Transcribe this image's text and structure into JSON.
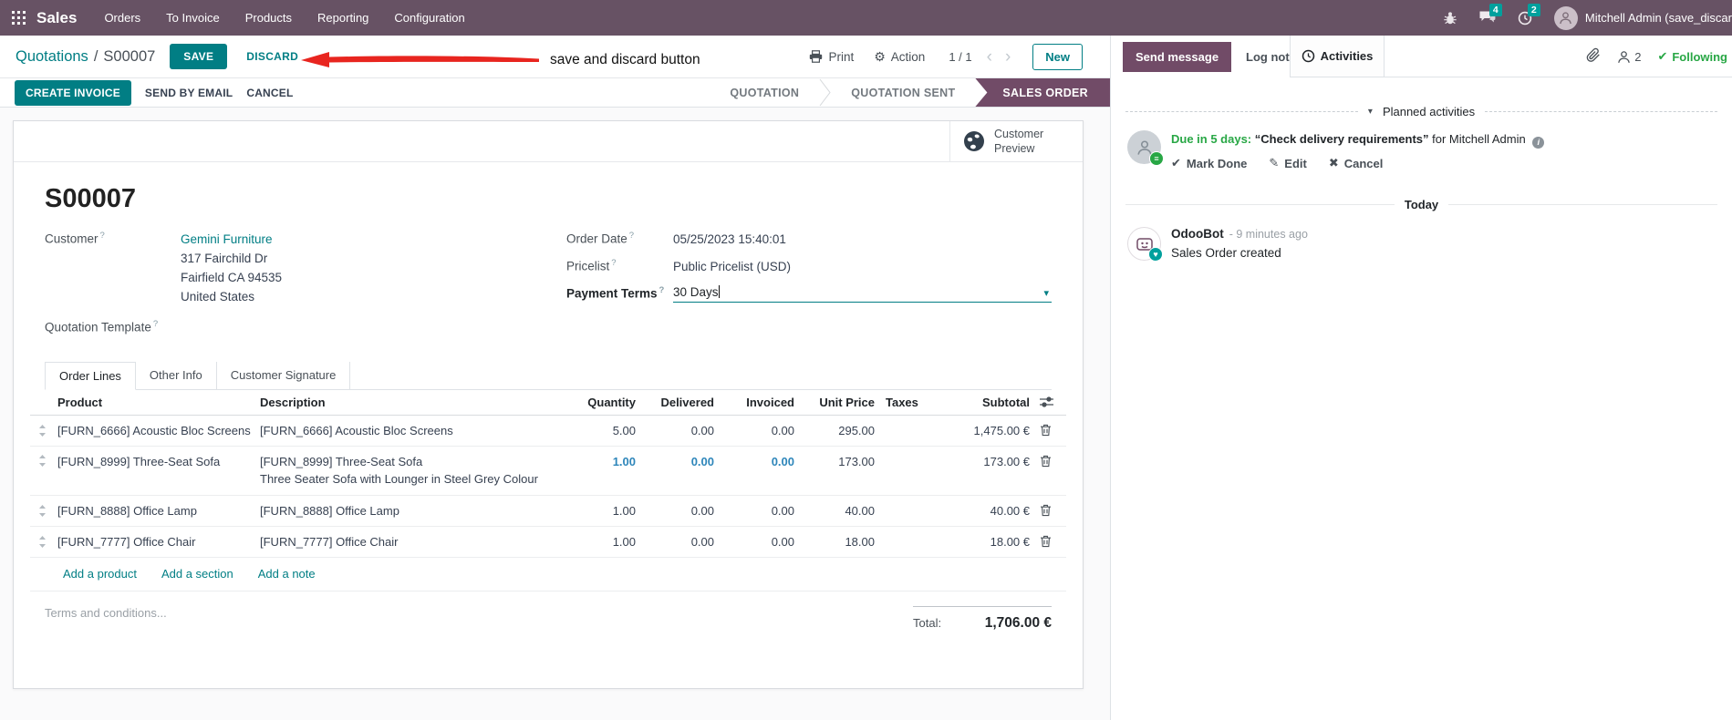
{
  "ui": {
    "help": "?",
    "caret_down": "▾",
    "chevron_left": "‹",
    "chevron_right": "›",
    "gear": "⚙",
    "check": "✔",
    "pencil": "✎",
    "cross": "✖",
    "heart": "♥",
    "list": "≡",
    "info": "i"
  },
  "colors": {
    "navbar": "#675264",
    "primary_teal": "#017e84",
    "purple": "#714B67",
    "badge_teal": "#00a09d",
    "green": "#28a745",
    "modified_blue": "#2e86ba",
    "annotation_red": "#e8251f"
  },
  "navbar": {
    "app": "Sales",
    "menus": [
      "Orders",
      "To Invoice",
      "Products",
      "Reporting",
      "Configuration"
    ],
    "message_count": "4",
    "activity_count": "2",
    "user": "Mitchell Admin (save_discar"
  },
  "breadcrumb": {
    "section": "Quotations",
    "separator": "/",
    "record": "S00007"
  },
  "controls": {
    "save": "SAVE",
    "discard": "DISCARD",
    "print": "Print",
    "action_menu": "Action",
    "pager": "1 / 1",
    "new": "New"
  },
  "annotation": {
    "text": "save and discard button"
  },
  "statusbar": {
    "create_invoice": "CREATE INVOICE",
    "send_by_email": "SEND BY EMAIL",
    "cancel": "CANCEL",
    "stages": [
      "QUOTATION",
      "QUOTATION SENT",
      "SALES ORDER"
    ]
  },
  "sheet": {
    "customer_preview": "Customer Preview",
    "title": "S00007",
    "labels": {
      "customer": "Customer",
      "quotation_template": "Quotation Template",
      "order_date": "Order Date",
      "pricelist": "Pricelist",
      "payment_terms": "Payment Terms"
    },
    "values": {
      "customer_name": "Gemini Furniture",
      "address": [
        "317 Fairchild Dr",
        "Fairfield CA 94535",
        "United States"
      ],
      "order_date": "05/25/2023 15:40:01",
      "pricelist": "Public Pricelist (USD)",
      "payment_terms": "30 Days"
    },
    "tabs": [
      "Order Lines",
      "Other Info",
      "Customer Signature"
    ],
    "table": {
      "columns": [
        "Product",
        "Description",
        "Quantity",
        "Delivered",
        "Invoiced",
        "Unit Price",
        "Taxes",
        "Subtotal"
      ],
      "rows": [
        {
          "product": "[FURN_6666] Acoustic Bloc Screens",
          "description": "[FURN_6666] Acoustic Bloc Screens",
          "description2": "",
          "quantity": "5.00",
          "delivered": "0.00",
          "invoiced": "0.00",
          "unit_price": "295.00",
          "taxes": "",
          "subtotal": "1,475.00 €"
        },
        {
          "product": "[FURN_8999] Three-Seat Sofa",
          "description": "[FURN_8999] Three-Seat Sofa",
          "description2": "Three Seater Sofa with Lounger in Steel Grey Colour",
          "quantity": "1.00",
          "delivered": "0.00",
          "invoiced": "0.00",
          "unit_price": "173.00",
          "taxes": "",
          "subtotal": "173.00 €"
        },
        {
          "product": "[FURN_8888] Office Lamp",
          "description": "[FURN_8888] Office Lamp",
          "description2": "",
          "quantity": "1.00",
          "delivered": "0.00",
          "invoiced": "0.00",
          "unit_price": "40.00",
          "taxes": "",
          "subtotal": "40.00 €"
        },
        {
          "product": "[FURN_7777] Office Chair",
          "description": "[FURN_7777] Office Chair",
          "description2": "",
          "quantity": "1.00",
          "delivered": "0.00",
          "invoiced": "0.00",
          "unit_price": "18.00",
          "taxes": "",
          "subtotal": "18.00 €"
        }
      ],
      "links": [
        "Add a product",
        "Add a section",
        "Add a note"
      ]
    },
    "terms_placeholder": "Terms and conditions...",
    "total_label": "Total:",
    "total_value": "1,706.00 €"
  },
  "chatter": {
    "send_message": "Send message",
    "log_note": "Log note",
    "activities": "Activities",
    "followers_count": "2",
    "following": "Following",
    "planned_activities": "Planned activities",
    "activity": {
      "due": "Due in 5 days:",
      "title": "“Check delivery requirements”",
      "assignee": "for Mitchell Admin",
      "mark_done": "Mark Done",
      "edit": "Edit",
      "cancel": "Cancel"
    },
    "today": "Today",
    "message": {
      "author": "OdooBot",
      "time": "- 9 minutes ago",
      "body": "Sales Order created"
    }
  }
}
